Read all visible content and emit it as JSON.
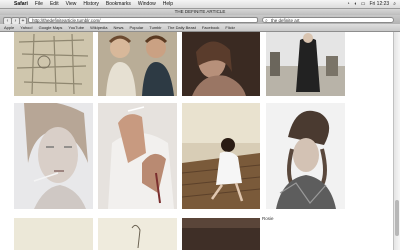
{
  "menubar": {
    "apple_icon": "apple-icon",
    "items": [
      "Safari",
      "File",
      "Edit",
      "View",
      "History",
      "Bookmarks",
      "Window",
      "Help"
    ],
    "clock": "Fri 12:23"
  },
  "window": {
    "title": "THE DEFINITE ARTICLE"
  },
  "toolbar": {
    "address": "http://thedefinitearticle.tumblr.com/",
    "search_value": "the definite art"
  },
  "bookmarks": {
    "items": [
      "Apple",
      "Yahoo!",
      "Google Maps",
      "YouTube",
      "Wikipedia",
      "News",
      "Popular",
      "Tumblr",
      "The Daily Beast",
      "Facebook",
      "Flickr"
    ]
  },
  "content": {
    "caption": "Rosie"
  }
}
